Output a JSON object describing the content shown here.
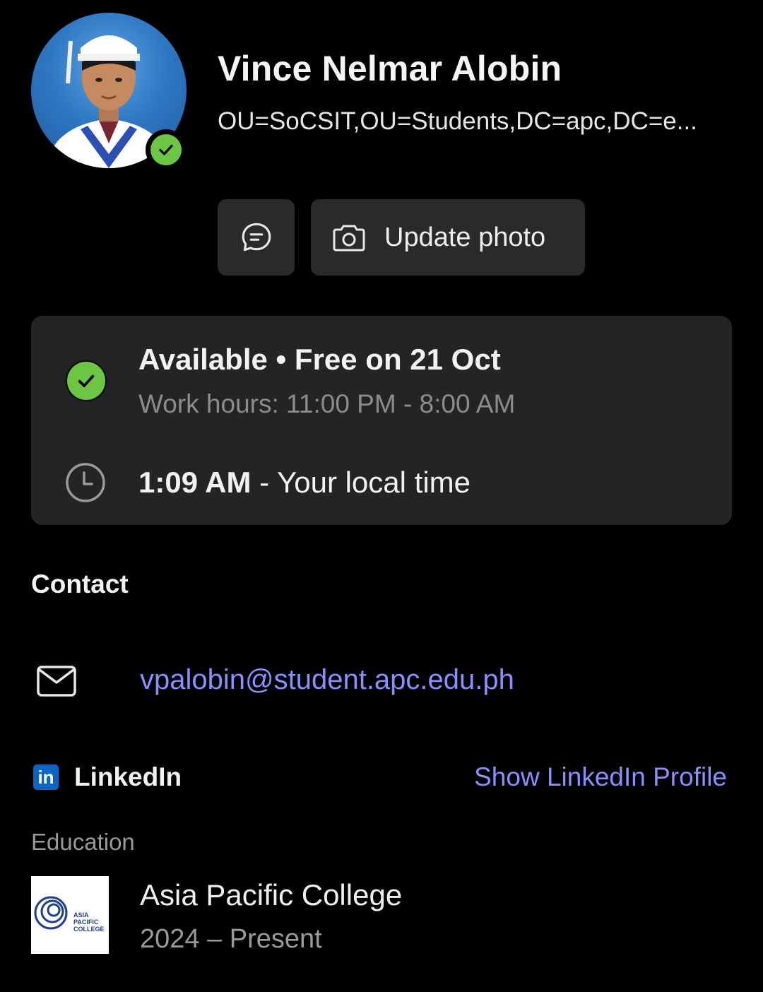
{
  "profile": {
    "name": "Vince Nelmar Alobin",
    "distinguished_name": "OU=SoCSIT,OU=Students,DC=apc,DC=e...",
    "presence_color": "#6cc644"
  },
  "actions": {
    "chat_icon": "chat-bubble-icon",
    "update_photo_label": "Update photo",
    "update_photo_icon": "camera-icon"
  },
  "availability": {
    "status": "Available • Free on 21 Oct",
    "work_hours": "Work hours: 11:00 PM - 8:00 AM",
    "local_time_value": "1:09 AM",
    "local_time_suffix": " - Your local time"
  },
  "contact": {
    "section_title": "Contact",
    "email": "vpalobin@student.apc.edu.ph"
  },
  "linkedin": {
    "logo_text": "in",
    "label": "LinkedIn",
    "link_text": "Show LinkedIn Profile"
  },
  "education": {
    "section_title": "Education",
    "school": "Asia Pacific College",
    "years": "2024 – Present",
    "logo_lines": [
      "ASIA",
      "PACIFIC",
      "COLLEGE"
    ]
  },
  "colors": {
    "background": "#000000",
    "card": "#242424",
    "link": "#8a8fff",
    "linkedin_brand": "#0a66c2"
  }
}
